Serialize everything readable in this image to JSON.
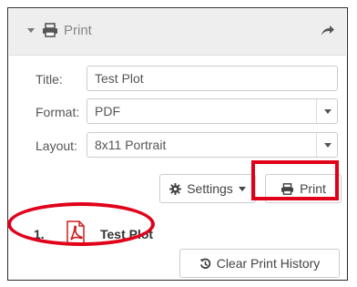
{
  "header": {
    "title": "Print",
    "print_icon": "printer-icon",
    "collapse_icon": "caret-down-icon",
    "share_icon": "share-arrow-icon"
  },
  "form": {
    "title_label": "Title:",
    "title_value": "Test Plot",
    "format_label": "Format:",
    "format_value": "PDF",
    "layout_label": "Layout:",
    "layout_value": "8x11 Portrait"
  },
  "buttons": {
    "settings_label": "Settings",
    "settings_icon": "gear-icon",
    "print_label": "Print",
    "clear_label": "Clear Print History",
    "clear_icon": "history-icon"
  },
  "history": [
    {
      "number": "1.",
      "title": "Test Plot",
      "icon": "pdf-icon"
    }
  ],
  "colors": {
    "highlight": "#e0001a",
    "pdf_red": "#cc1f1f",
    "header_bg": "#eeeeee"
  }
}
